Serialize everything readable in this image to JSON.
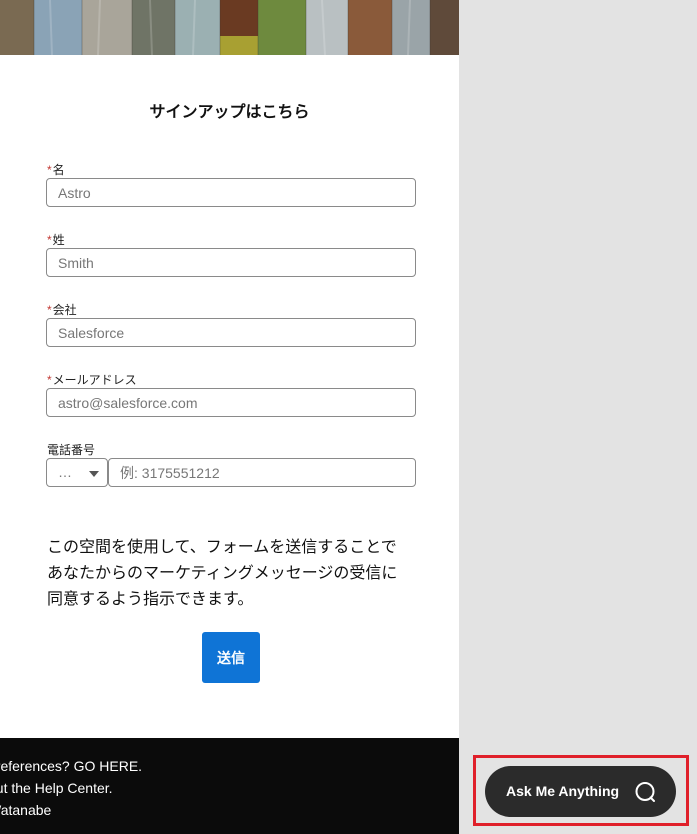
{
  "form": {
    "title": "サインアップはこちら",
    "required_mark": "*",
    "fields": {
      "first_name": {
        "label": "名",
        "placeholder": "Astro"
      },
      "last_name": {
        "label": "姓",
        "placeholder": "Smith"
      },
      "company": {
        "label": "会社",
        "placeholder": "Salesforce"
      },
      "email": {
        "label": "メールアドレス",
        "placeholder": "astro@salesforce.com"
      },
      "phone": {
        "label": "電話番号",
        "country_code_value": "…",
        "placeholder": "例: 3175551212"
      }
    },
    "consent_lines": [
      "この空間を使用して、フォームを送信することで",
      "あなたからのマーケティングメッセージの受信に",
      "同意するよう指示できます。"
    ],
    "submit_label": "送信"
  },
  "footer": {
    "lines": [
      "preferences? GO HERE.",
      "out the Help Center.",
      "Watanabe"
    ]
  },
  "chat": {
    "button_label": "Ask Me Anything",
    "icon": "chat-bubble-icon"
  },
  "colors": {
    "submit_bg": "#0f74d6",
    "required": "#c23934",
    "chat_bg": "#2b2b2b",
    "highlight": "#e0202a"
  }
}
